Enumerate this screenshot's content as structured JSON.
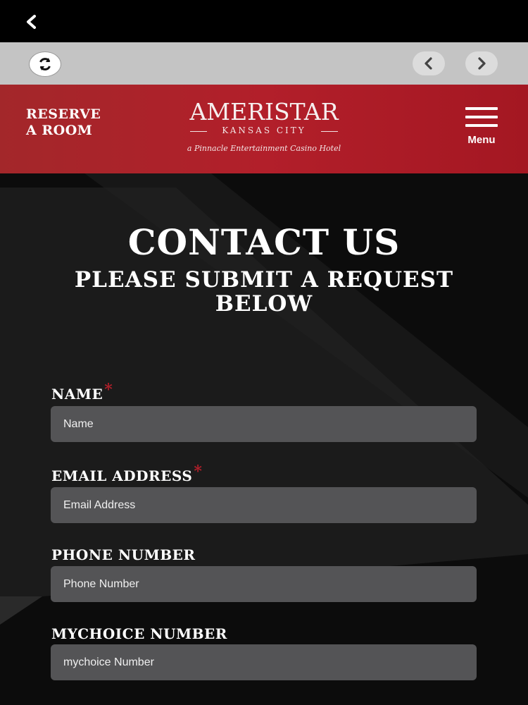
{
  "nav": {
    "back_icon": "chevron-left-icon"
  },
  "toolbar": {
    "refresh_icon": "refresh-icon",
    "prev_icon": "chevron-left-icon",
    "next_icon": "chevron-right-icon"
  },
  "header": {
    "reserve_line1": "RESERVE",
    "reserve_line2": "A ROOM",
    "logo_main": "AMERISTAR",
    "logo_sub": "KANSAS CITY",
    "logo_tagline": "a Pinnacle Entertainment Casino Hotel",
    "menu_label": "Menu",
    "menu_icon": "hamburger-menu-icon",
    "brand_color": "#b21f2a"
  },
  "page": {
    "title": "CONTACT US",
    "subtitle": "PLEASE SUBMIT A REQUEST BELOW"
  },
  "form": {
    "name": {
      "label": "NAME",
      "required": "*",
      "placeholder": "Name"
    },
    "email": {
      "label": "EMAIL ADDRESS",
      "required": "*",
      "placeholder": "Email Address"
    },
    "phone": {
      "label": "PHONE NUMBER",
      "placeholder": "Phone Number"
    },
    "mychoice": {
      "label": "MYCHOICE NUMBER",
      "placeholder": "mychoice Number"
    }
  }
}
